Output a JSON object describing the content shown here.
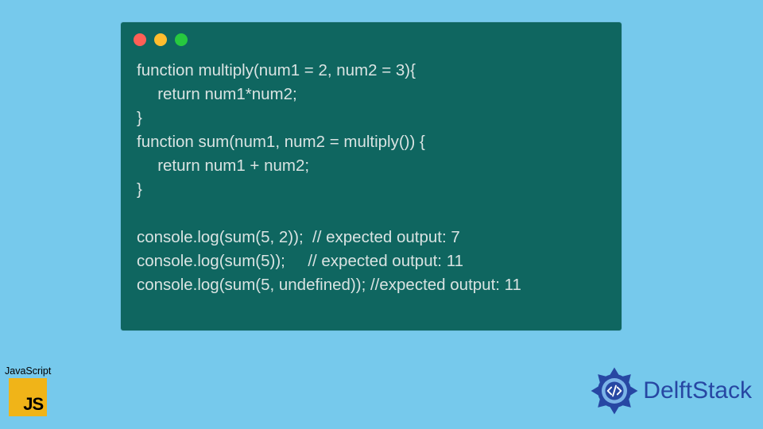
{
  "code_window": {
    "dots": [
      "red",
      "yellow",
      "green"
    ],
    "code": "function multiply(num1 = 2, num2 = 3){\n  return num1*num2;\n}\nfunction sum(num1, num2 = multiply()) {\n  return num1 + num2;\n}\n\nconsole.log(sum(5, 2));  // expected output: 7\nconsole.log(sum(5));     // expected output: 11\nconsole.log(sum(5, undefined)); //expected output: 11"
  },
  "js_badge": {
    "label": "JavaScript",
    "logo_text": "JS",
    "logo_color": "#f0b418"
  },
  "brand": {
    "name": "DelftStack",
    "color": "#2747a3"
  }
}
